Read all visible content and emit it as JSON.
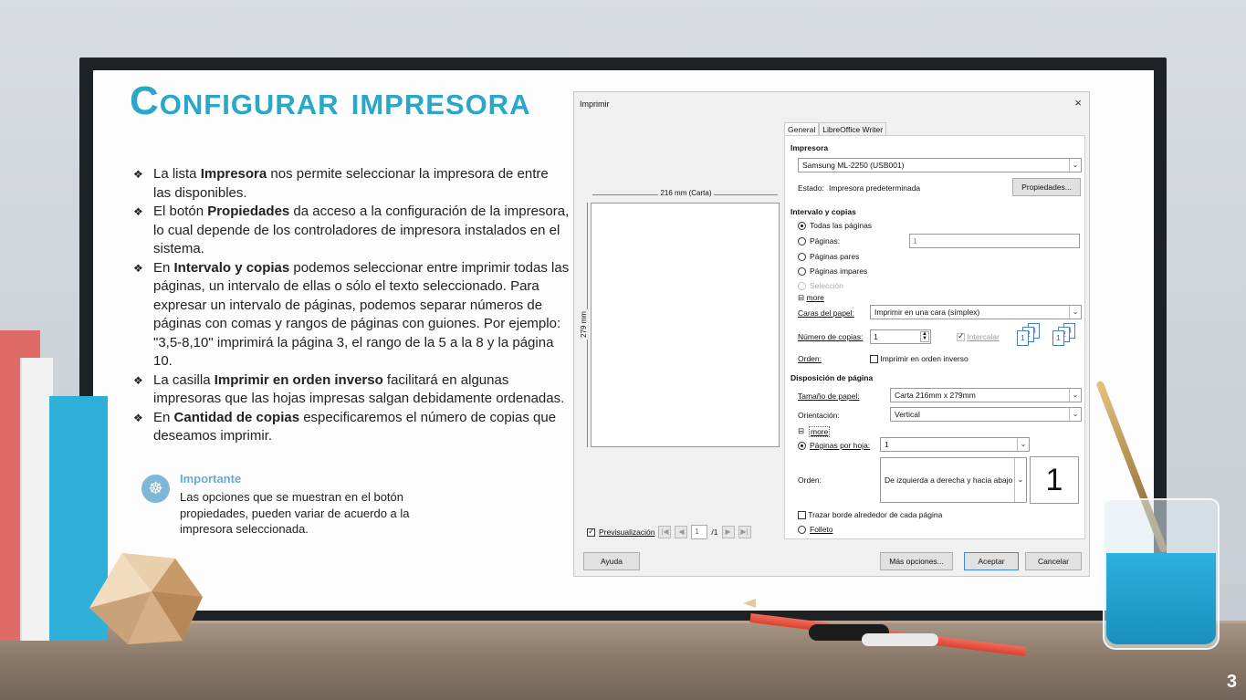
{
  "slide": {
    "title": "Configurar impresora",
    "page_number": "3",
    "bullet_marker": "❖",
    "bullets": [
      [
        "La lista ",
        "Impresora",
        " nos permite seleccionar la impresora de entre las disponibles."
      ],
      [
        "El botón ",
        "Propiedades",
        " da acceso a la configuración de la impresora, lo cual depende de los controladores de impresora instalados en el sistema."
      ],
      [
        "En ",
        "Intervalo y copias",
        " podemos seleccionar entre imprimir todas las páginas, un intervalo de ellas o sólo el texto seleccionado.  Para expresar un intervalo de páginas, podemos separar números de páginas con comas y rangos de páginas con guiones.  Por ejemplo: \"3,5-8,10\" imprimirá la página 3, el rango de la 5 a la 8 y la página 10."
      ],
      [
        "La casilla ",
        "Imprimir en orden inverso",
        " facilitará en algunas impresoras que las hojas impresas salgan debidamente ordenadas."
      ],
      [
        "En ",
        "Cantidad de copias",
        " especificaremos el número de copias que deseamos imprimir."
      ]
    ],
    "note": {
      "title": "Importante",
      "body": "Las opciones que se muestran en el botón propiedades, pueden variar de acuerdo a la impresora seleccionada."
    }
  },
  "dialog": {
    "title": "Imprimir",
    "close": "×",
    "preview": {
      "width_label": "216 mm (Carta)",
      "height_label": "279 mm",
      "preview_checkbox": "Previsualización",
      "page_value": "1",
      "page_total": "/1"
    },
    "tabs": [
      "General",
      "LibreOffice Writer"
    ],
    "printer": {
      "heading": "Impresora",
      "selected": "Samsung ML-2250 (USB001)",
      "status_label": "Estado:",
      "status_value": "Impresora predeterminada",
      "properties_button": "Propiedades..."
    },
    "range": {
      "heading": "Intervalo y copias",
      "all_pages": "Todas las páginas",
      "pages": "Páginas:",
      "pages_value": "1",
      "even_pages": "Páginas pares",
      "odd_pages": "Páginas impares",
      "selection": "Selección",
      "more": "more",
      "paper_sides_label": "Caras del papel:",
      "paper_sides_value": "Imprimir en una cara (símplex)",
      "copies_label": "Número de copias:",
      "copies_value": "1",
      "collate": "Intercalar",
      "order_label": "Orden:",
      "reverse_order": "Imprimir en orden inverso"
    },
    "layout": {
      "heading": "Disposición de página",
      "paper_size_label": "Tamaño de papel:",
      "paper_size_value": "Carta 216mm x 279mm",
      "orientation_label": "Orientación:",
      "orientation_value": "Vertical",
      "more": "more",
      "pages_per_sheet_label": "Páginas por hoja:",
      "pages_per_sheet_value": "1",
      "order_label": "Orden:",
      "order_value": "De izquierda a derecha y hacia abajo",
      "order_preview": "1",
      "border": "Trazar borde alrededor de cada página",
      "brochure": "Folleto"
    },
    "buttons": {
      "help": "Ayuda",
      "more_options": "Más opciones...",
      "ok": "Aceptar",
      "cancel": "Cancelar"
    }
  }
}
